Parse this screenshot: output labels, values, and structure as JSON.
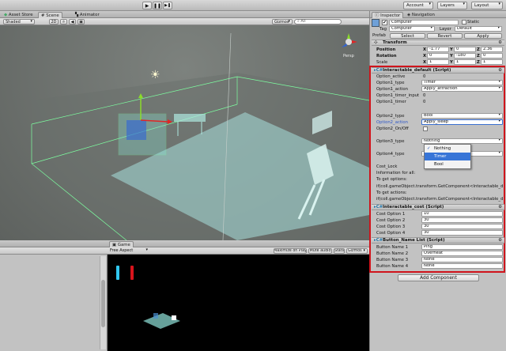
{
  "toolbar": {
    "account": "Account",
    "layers": "Layers",
    "layout": "Layout"
  },
  "tabs": {
    "asset_store": "Asset Store",
    "scene": "Scene",
    "animator": "Animator",
    "game": "Game",
    "inspector": "Inspector",
    "navigation": "Navigation"
  },
  "scene_bar": {
    "shading": "Shaded",
    "mode": "2D",
    "gizmos": "Gizmos",
    "search": "All",
    "persp": "Persp"
  },
  "game_bar": {
    "aspect": "Free Aspect",
    "maximize": "Maximize on Play",
    "mute": "Mute audio",
    "stats": "Stats",
    "gizmos": "Gizmos"
  },
  "object": {
    "name": "Computer",
    "static": "Static",
    "tag_label": "Tag",
    "tag_value": "Computer",
    "layer_label": "Layer",
    "layer_value": "Default",
    "prefab_label": "Prefab",
    "select": "Select",
    "revert": "Revert",
    "apply": "Apply"
  },
  "transform": {
    "title": "Transform",
    "position_label": "Position",
    "rotation_label": "Rotation",
    "scale_label": "Scale",
    "position": [
      "-1.77",
      "0",
      "2.36"
    ],
    "rotation": [
      "0",
      "-180",
      "0"
    ],
    "scale": [
      "1",
      "1",
      "1"
    ]
  },
  "interactable": {
    "title": "Interactable_default (Script)",
    "rows": [
      {
        "label": "Option_active",
        "value": "0",
        "type": "text"
      },
      {
        "label": "Option1_type",
        "value": "Timer",
        "type": "dropdown"
      },
      {
        "label": "Option1_action",
        "value": "Apply_attraction",
        "type": "dropdown"
      },
      {
        "label": "Option1_timer_input",
        "value": "0",
        "type": "text"
      },
      {
        "label": "Option1_timer",
        "value": "0",
        "type": "text"
      },
      {
        "label": "Option2_type",
        "value": "Bool",
        "type": "dropdown"
      },
      {
        "label": "Option2_action",
        "value": "Apply_sleep",
        "type": "dropdown"
      },
      {
        "label": "Option2_On/Off",
        "value": "",
        "type": "checkbox"
      },
      {
        "label": "Option3_type",
        "value": "Nothing",
        "type": "dropdown"
      },
      {
        "label": "Option4_type",
        "value": "",
        "type": "dropdown"
      }
    ],
    "cost_lock": "Cost_Lock",
    "info": [
      "Information for all:",
      "To get options:",
      "if(coll.gameObject.transform.GetComponent<Interactable_def",
      "To get actions:",
      "if(coll.gameObject.transform.GetComponent<Interactable_def"
    ],
    "dropdown_options": [
      "Nothing",
      "Timer",
      "Bool"
    ],
    "dropdown_checked": "Nothing",
    "dropdown_highlight": "Timer"
  },
  "cost": {
    "title": "Interactable_cost (Script)",
    "rows": [
      {
        "label": "Cost Option 1",
        "value": "10"
      },
      {
        "label": "Cost Option 2",
        "value": "30"
      },
      {
        "label": "Cost Option 3",
        "value": "30"
      },
      {
        "label": "Cost Option 4",
        "value": "30"
      }
    ]
  },
  "button_names": {
    "title": "Button_Name List (Script)",
    "rows": [
      {
        "label": "Button Name 1",
        "value": "Ping"
      },
      {
        "label": "Button Name 2",
        "value": "Overheat"
      },
      {
        "label": "Button Name 3",
        "value": "None"
      },
      {
        "label": "Button Name 4",
        "value": "None"
      }
    ]
  },
  "add_component": "Add Component",
  "colors": {
    "highlight": "#d0141c",
    "selection": "#3875d7",
    "scene_bg": "#6f7470"
  }
}
